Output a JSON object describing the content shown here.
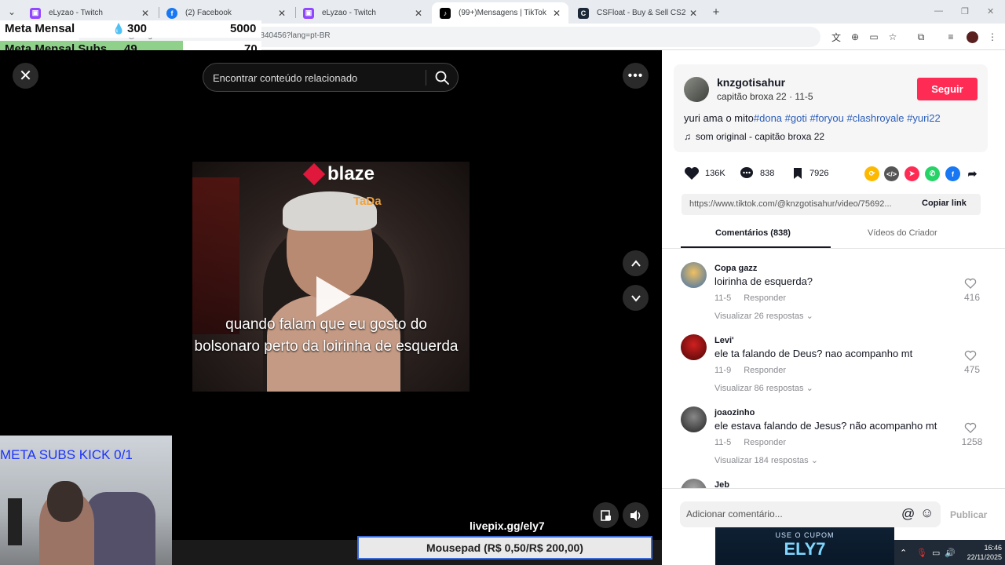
{
  "browser": {
    "tabs": [
      {
        "label": "eLyzao - Twitch",
        "icon": "twitch-icon",
        "color": "#9146ff",
        "active": false
      },
      {
        "label": "(2) Facebook",
        "icon": "facebook-icon",
        "color": "#1877f2",
        "active": false
      },
      {
        "label": "eLyzao - Twitch",
        "icon": "twitch-icon",
        "color": "#9146ff",
        "active": false
      },
      {
        "label": "(99+)Mensagens | TikTok",
        "icon": "tiktok-icon",
        "color": "#000000",
        "active": true
      },
      {
        "label": "CSFloat - Buy & Sell CS2 Skins",
        "icon": "csfloat-icon",
        "color": "#1b2838",
        "active": false
      }
    ],
    "url": "tiktok.com/@knzgotisahur/video/7569287725224840456?lang=pt-BR"
  },
  "stream_overlay": {
    "meta_mensal_label": "Meta Mensal",
    "meta_mensal_current": "300",
    "meta_mensal_target": "5000",
    "meta_subs_label": "Meta Mensal Subs",
    "meta_subs_current": "49",
    "meta_subs_target": "70",
    "meta_subs_progress": 0.7,
    "webcam_text": "META SUBS KICK 0/1",
    "livepix": "livepix.gg/ely7",
    "mousepad": "Mousepad (R$ 0,50/R$ 200,00)",
    "coupon_top": "USE O CUPOM",
    "coupon_code": "ELY7"
  },
  "video": {
    "search_placeholder": "Encontrar conteúdo relacionado",
    "brand": "blaze",
    "brand2": "TaDa",
    "caption": "quando falam que eu gosto do bolsonaro perto da loirinha de esquerda"
  },
  "post": {
    "username": "knzgotisahur",
    "display_name": "capitão broxa 22",
    "date": "11-5",
    "follow_label": "Seguir",
    "description_text": "yuri ama o mito",
    "hashtags": [
      "#dona",
      "#goti",
      "#foryou",
      "#clashroyale",
      "#yuri22"
    ],
    "music": "som original - capitão broxa 22",
    "likes": "136K",
    "comments": "838",
    "saves": "7926",
    "link": "https://www.tiktok.com/@knzgotisahur/video/75692...",
    "copy_label": "Copiar link"
  },
  "tabs": {
    "comments": "Comentários (838)",
    "creator_videos": "Vídeos do Criador"
  },
  "comments": [
    {
      "name": "Copa gazz",
      "text": "loirinha de esquerda?",
      "date": "11-5",
      "reply": "Responder",
      "replies": "Visualizar 26 respostas",
      "likes": "416",
      "avatar_color": "#3a6fb0"
    },
    {
      "name": "Levi'",
      "text": "ele ta falando de Deus? nao acompanho mt",
      "date": "11-9",
      "reply": "Responder",
      "replies": "Visualizar 86 respostas",
      "likes": "475",
      "avatar_color": "#8a1010"
    },
    {
      "name": "joaozinho",
      "text": "ele estava falando de Jesus? não acompanho mt",
      "date": "11-5",
      "reply": "Responder",
      "replies": "Visualizar 184 respostas",
      "likes": "1258",
      "avatar_color": "#444444"
    },
    {
      "name": "Jeb",
      "text": "",
      "date": "",
      "reply": "",
      "replies": "",
      "likes": "",
      "avatar_color": "#777777"
    }
  ],
  "add_comment_placeholder": "Adicionar comentário...",
  "publish_label": "Publicar",
  "clock": {
    "time": "16:46",
    "date": "22/11/2025"
  }
}
